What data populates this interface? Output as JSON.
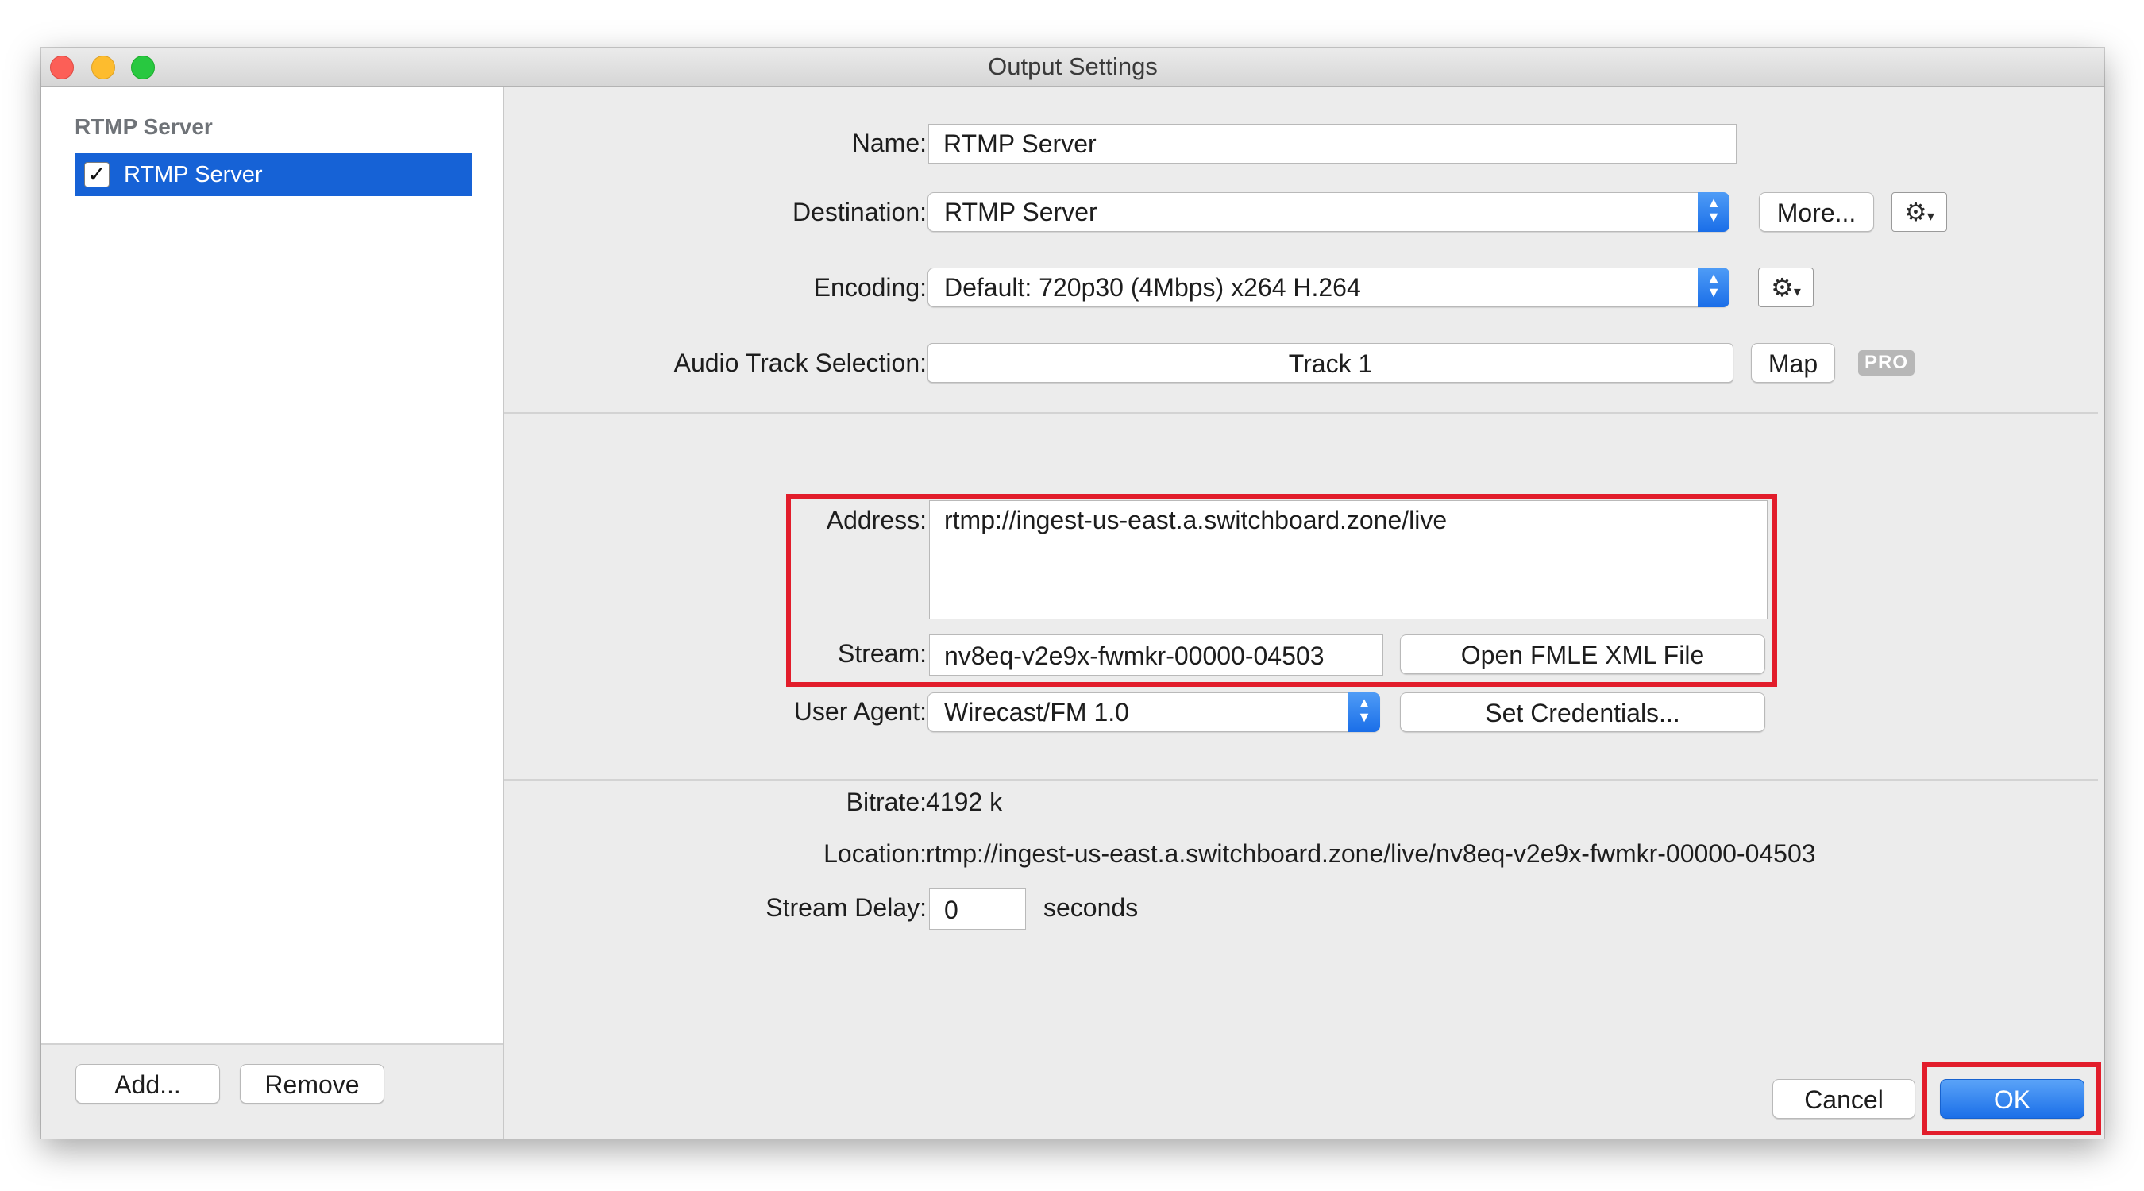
{
  "window": {
    "title": "Output Settings"
  },
  "sidebar": {
    "header": "RTMP Server",
    "items": [
      {
        "label": "RTMP Server",
        "checked": true
      }
    ],
    "add_label": "Add...",
    "remove_label": "Remove"
  },
  "form": {
    "name": {
      "label": "Name:",
      "value": "RTMP Server"
    },
    "destination": {
      "label": "Destination:",
      "value": "RTMP Server",
      "more_label": "More..."
    },
    "encoding": {
      "label": "Encoding:",
      "value": "Default: 720p30 (4Mbps) x264 H.264"
    },
    "audio_track": {
      "label": "Audio Track Selection:",
      "value": "Track 1",
      "map_label": "Map",
      "pro_badge": "PRO"
    },
    "address": {
      "label": "Address:",
      "value": "rtmp://ingest-us-east.a.switchboard.zone/live"
    },
    "stream": {
      "label": "Stream:",
      "value": "nv8eq-v2e9x-fwmkr-00000-04503",
      "open_fmle_label": "Open FMLE XML File"
    },
    "user_agent": {
      "label": "User Agent:",
      "value": "Wirecast/FM 1.0",
      "set_credentials_label": "Set Credentials..."
    }
  },
  "info": {
    "bitrate": {
      "label": "Bitrate:",
      "value": "4192 k"
    },
    "location": {
      "label": "Location:",
      "value": "rtmp://ingest-us-east.a.switchboard.zone/live/nv8eq-v2e9x-fwmkr-00000-04503"
    },
    "stream_delay": {
      "label": "Stream Delay:",
      "value": "0",
      "unit": "seconds"
    }
  },
  "footer": {
    "cancel_label": "Cancel",
    "ok_label": "OK"
  },
  "colors": {
    "accent": "#1662d6",
    "highlight": "#e21d2b"
  },
  "icons": {
    "gear": "gear-icon",
    "stepper": "up-down-arrows-icon",
    "check": "checkmark-icon"
  }
}
